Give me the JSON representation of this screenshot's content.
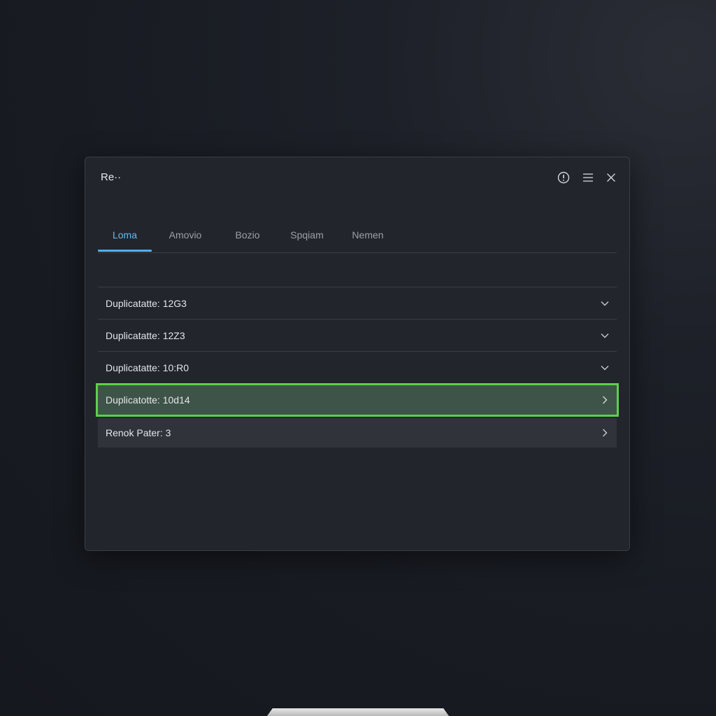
{
  "window": {
    "title": "Re··"
  },
  "window_controls": {
    "info_icon": "info-circle-icon",
    "menu_icon": "hamburger-menu-icon",
    "close_icon": "close-icon"
  },
  "tabs": [
    {
      "label": "Loma",
      "active": true
    },
    {
      "label": "Amovio",
      "active": false
    },
    {
      "label": "Bozio",
      "active": false
    },
    {
      "label": "Spqiam",
      "active": false
    },
    {
      "label": "Nemen",
      "active": false
    }
  ],
  "rows": [
    {
      "label": "Duplicatatte: 12G3",
      "icon": "chevron-down-icon"
    },
    {
      "label": "Duplicatatte: 12Z3",
      "icon": "chevron-down-icon"
    },
    {
      "label": "Duplicatatte: 10:R0",
      "icon": "chevron-down-icon"
    },
    {
      "label": "Duplicatotte: 10d14",
      "icon": "chevron-right-icon",
      "selected": true
    },
    {
      "label": "Renok Pater: 3",
      "icon": "chevron-right-icon"
    }
  ],
  "colors": {
    "accent": "#55aee6",
    "selection_border": "#5bd148",
    "selection_fill": "#3f5448",
    "window_bg": "#22252c"
  }
}
